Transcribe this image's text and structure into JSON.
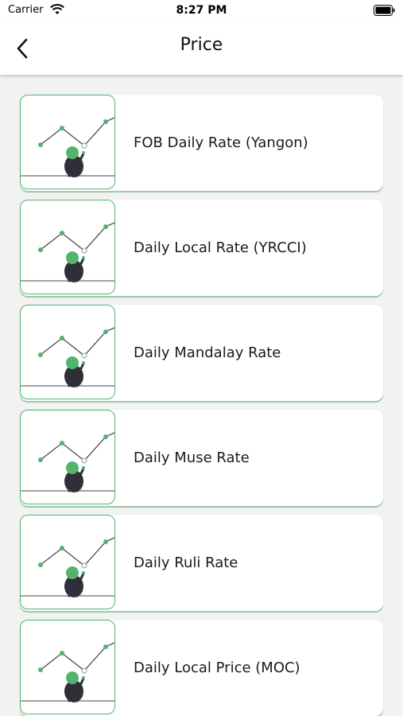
{
  "status_bar": {
    "carrier": "Carrier",
    "time": "8:27 PM"
  },
  "header": {
    "title": "Price"
  },
  "items": [
    {
      "label": "FOB Daily Rate (Yangon)"
    },
    {
      "label": "Daily Local Rate (YRCCI)"
    },
    {
      "label": "Daily Mandalay Rate"
    },
    {
      "label": "Daily Muse Rate"
    },
    {
      "label": "Daily Ruli Rate"
    },
    {
      "label": "Daily Local Price (MOC)"
    }
  ],
  "colors": {
    "accent": "#52b46d",
    "character": "#2f2f3a",
    "background": "#f2f2f2"
  },
  "icons": {
    "back": "chevron-left-icon",
    "wifi": "wifi-icon",
    "battery": "battery-icon",
    "thumbnail": "price-chart-illustration"
  }
}
